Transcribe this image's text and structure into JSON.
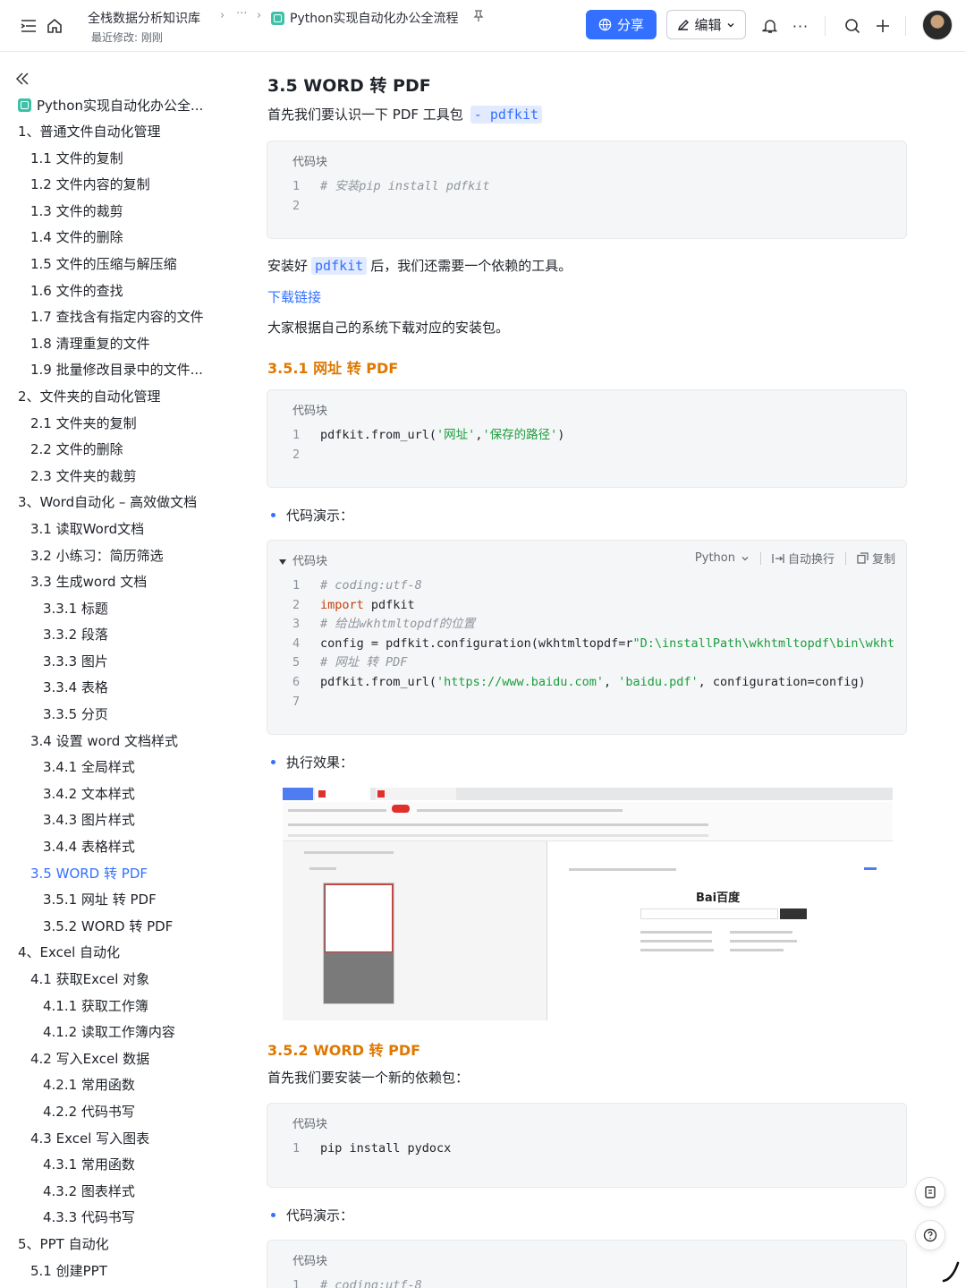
{
  "topbar": {
    "breadcrumb_root": "全栈数据分析知识库",
    "breadcrumb_sep": "›",
    "breadcrumb_more": "···",
    "last_modified": "最近修改: 刚刚",
    "doc_title": "Python实现自动化办公全流程",
    "share_label": "分享",
    "edit_label": "编辑",
    "more_label": "···"
  },
  "sidebar": {
    "root": "Python实现自动化办公全...",
    "items": [
      {
        "label": "1、普通文件自动化管理",
        "level": 1
      },
      {
        "label": "1.1 文件的复制",
        "level": 2
      },
      {
        "label": "1.2 文件内容的复制",
        "level": 2
      },
      {
        "label": "1.3 文件的裁剪",
        "level": 2
      },
      {
        "label": "1.4 文件的删除",
        "level": 2
      },
      {
        "label": "1.5 文件的压缩与解压缩",
        "level": 2
      },
      {
        "label": "1.6 文件的查找",
        "level": 2
      },
      {
        "label": "1.7 查找含有指定内容的文件",
        "level": 2
      },
      {
        "label": "1.8 清理重复的文件",
        "level": 2
      },
      {
        "label": "1.9 批量修改目录中的文件...",
        "level": 2
      },
      {
        "label": "2、文件夹的自动化管理",
        "level": 1
      },
      {
        "label": "2.1 文件夹的复制",
        "level": 2
      },
      {
        "label": "2.2 文件的删除",
        "level": 2
      },
      {
        "label": "2.3 文件夹的裁剪",
        "level": 2
      },
      {
        "label": "3、Word自动化 – 高效做文档",
        "level": 1
      },
      {
        "label": "3.1 读取Word文档",
        "level": 2
      },
      {
        "label": "3.2 小练习：简历筛选",
        "level": 2
      },
      {
        "label": "3.3 生成word 文档",
        "level": 2
      },
      {
        "label": "3.3.1 标题",
        "level": 3
      },
      {
        "label": "3.3.2 段落",
        "level": 3
      },
      {
        "label": "3.3.3 图片",
        "level": 3
      },
      {
        "label": "3.3.4 表格",
        "level": 3
      },
      {
        "label": "3.3.5 分页",
        "level": 3
      },
      {
        "label": "3.4 设置 word 文档样式",
        "level": 2
      },
      {
        "label": "3.4.1 全局样式",
        "level": 3
      },
      {
        "label": "3.4.2 文本样式",
        "level": 3
      },
      {
        "label": "3.4.3 图片样式",
        "level": 3
      },
      {
        "label": "3.4.4 表格样式",
        "level": 3
      },
      {
        "label": "3.5 WORD 转 PDF",
        "level": 2,
        "active": true
      },
      {
        "label": "3.5.1 网址 转 PDF",
        "level": 3
      },
      {
        "label": "3.5.2 WORD 转 PDF",
        "level": 3
      },
      {
        "label": "4、Excel 自动化",
        "level": 1
      },
      {
        "label": "4.1 获取Excel 对象",
        "level": 2
      },
      {
        "label": "4.1.1 获取工作簿",
        "level": 3
      },
      {
        "label": "4.1.2 读取工作簿内容",
        "level": 3
      },
      {
        "label": "4.2 写入Excel 数据",
        "level": 2
      },
      {
        "label": "4.2.1 常用函数",
        "level": 3
      },
      {
        "label": "4.2.2 代码书写",
        "level": 3
      },
      {
        "label": "4.3 Excel 写入图表",
        "level": 2
      },
      {
        "label": "4.3.1 常用函数",
        "level": 3
      },
      {
        "label": "4.3.2 图表样式",
        "level": 3
      },
      {
        "label": "4.3.3 代码书写",
        "level": 3
      },
      {
        "label": "5、PPT 自动化",
        "level": 1
      },
      {
        "label": "5.1 创建PPT",
        "level": 2
      }
    ]
  },
  "main": {
    "h2": "3.5 WORD 转 PDF",
    "intro_text": "首先我们要认识一下 PDF 工具包",
    "intro_code": "- pdfkit",
    "code_label": "代码块",
    "cb1": {
      "l1_num": "1",
      "l1": "# 安装pip install pdfkit",
      "l2_num": "2"
    },
    "after_install_1": "安装好",
    "after_install_code": "pdfkit",
    "after_install_2": "后，我们还需要一个依赖的工具。",
    "download_link": "下载链接",
    "download_text": "大家根据自己的系统下载对应的安装包。",
    "h3_1": "3.5.1 网址 转 PDF",
    "cb2": {
      "l1_num": "1",
      "l1_a": "pdfkit.from_url(",
      "l1_s1": "'网址'",
      "l1_b": ",",
      "l1_s2": "'保存的路径'",
      "l1_c": ")",
      "l2_num": "2"
    },
    "bullet_demo": "代码演示：",
    "cb3": {
      "lang": "Python",
      "wrap": "自动换行",
      "copy": "复制",
      "n1": "1",
      "l1": "# coding:utf-8",
      "n2": "2",
      "l2_kw": "import",
      "l2": " pdfkit",
      "n3": "3",
      "l3": "# 给出wkhtmltopdf的位置",
      "n4": "4",
      "l4_a": "config = pdfkit.configuration(wkhtmltopdf=r",
      "l4_s": "\"D:\\installPath\\wkhtmltopdf\\bin\\wkht",
      "n5": "5",
      "l5": "# 网址 转 PDF",
      "n6": "6",
      "l6_a": "pdfkit.from_url(",
      "l6_s1": "'https://www.baidu.com'",
      "l6_b": ", ",
      "l6_s2": "'baidu.pdf'",
      "l6_c": ", configuration=config)",
      "n7": "7"
    },
    "bullet_result": "执行效果：",
    "shot_logo": "Bai百度",
    "h3_2": "3.5.2 WORD 转 PDF",
    "word_intro": "首先我们要安装一个新的依赖包：",
    "cb4": {
      "n1": "1",
      "l1": "pip install pydocx"
    },
    "bullet_demo2": "代码演示：",
    "cb5": {
      "n1": "1",
      "l1": "# coding:utf-8"
    }
  }
}
